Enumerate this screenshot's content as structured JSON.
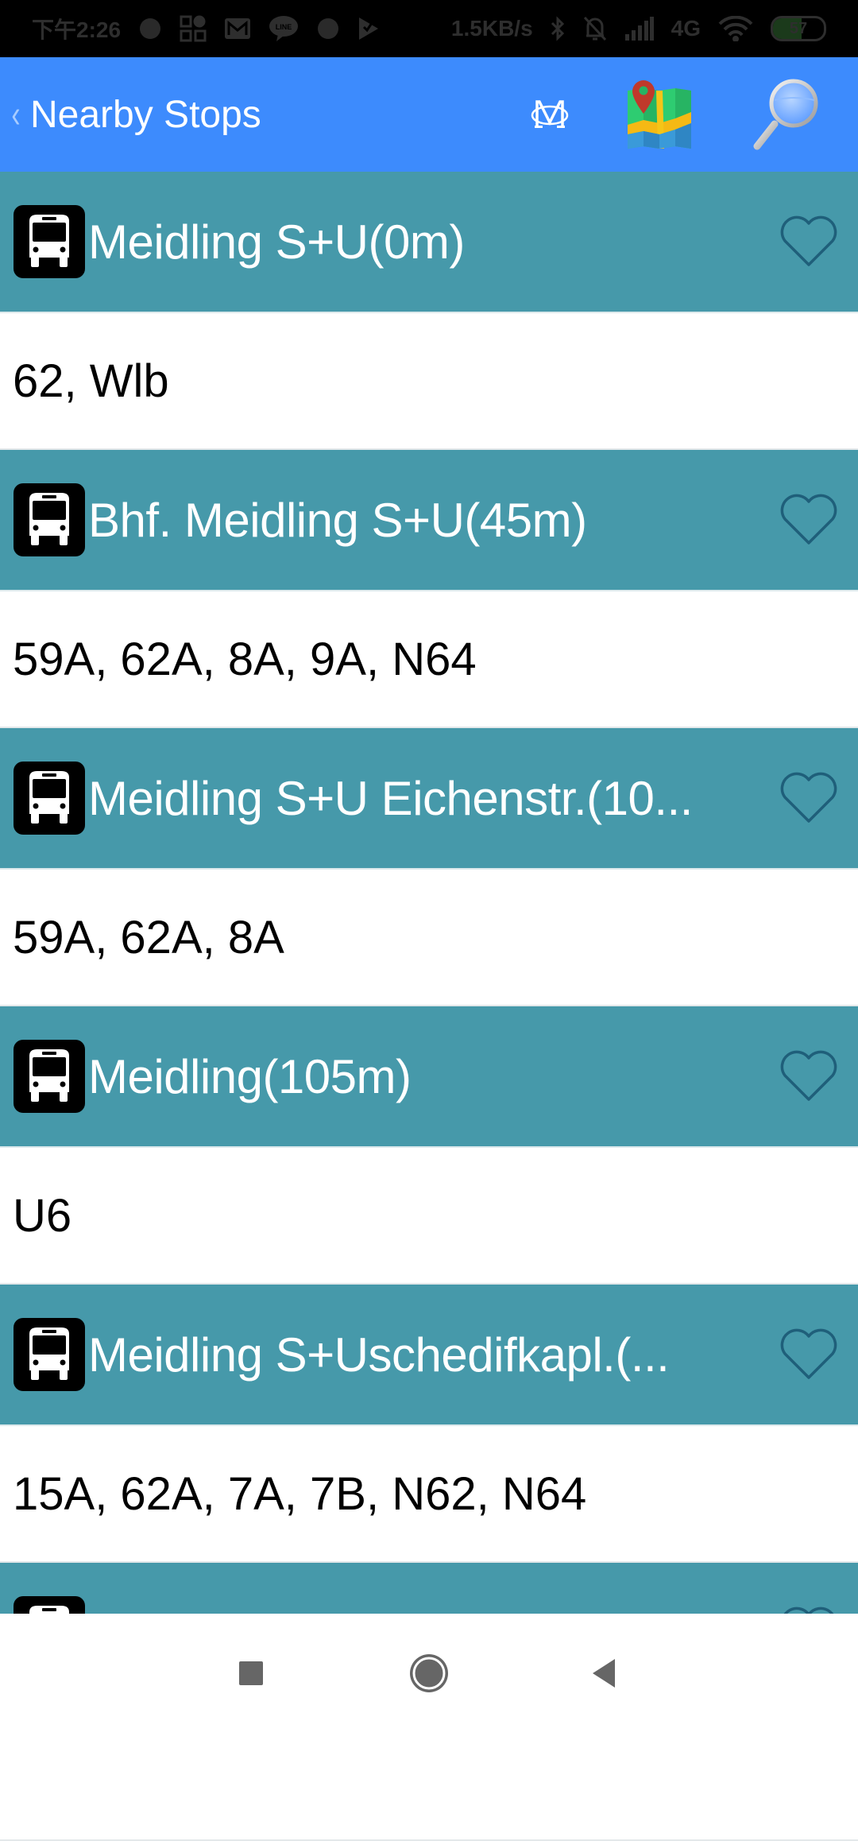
{
  "status_bar": {
    "time": "下午2:26",
    "notification_icons": [
      "loading-icon",
      "apps-grid-icon",
      "gmail-icon",
      "line-icon",
      "loading-icon",
      "play-store-icon"
    ],
    "network_speed": "1.5KB/s",
    "system_icons": [
      "bluetooth-icon",
      "mute-bell-icon",
      "signal-icon",
      "wifi-icon"
    ],
    "network_type": "4G",
    "battery_level": "57"
  },
  "header": {
    "back_label": "‹",
    "title": "Nearby Stops",
    "actions": [
      "metro-icon",
      "map-icon",
      "search-icon"
    ],
    "accent_color": "#3d8bfd"
  },
  "stops": [
    {
      "name": "Meidling S+U(0m)",
      "routes": "62, Wlb",
      "favorite": false
    },
    {
      "name": "Bhf. Meidling S+U(45m)",
      "routes": "59A, 62A, 8A, 9A, N64",
      "favorite": false
    },
    {
      "name": "Meidling S+U Eichenstr.(10...",
      "routes": "59A, 62A, 8A",
      "favorite": false
    },
    {
      "name": "Meidling(105m)",
      "routes": "U6",
      "favorite": false
    },
    {
      "name": "Meidling S+Uschedifkapl.(...",
      "routes": "15A, 62A, 7A, 7B, N62, N64",
      "favorite": false
    },
    {
      "name": "",
      "routes": "",
      "favorite": false
    }
  ],
  "colors": {
    "stop_header_bg": "#4699aa",
    "heart_outline": "#1f5f7a"
  },
  "nav_bar": {
    "buttons": [
      "recents-button",
      "home-button",
      "back-button"
    ]
  }
}
